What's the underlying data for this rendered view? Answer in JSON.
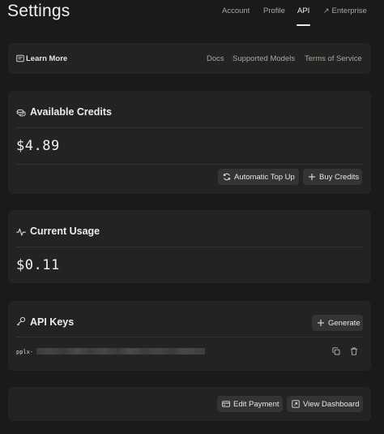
{
  "header": {
    "title": "Settings",
    "tabs": [
      {
        "label": "Account"
      },
      {
        "label": "Profile"
      },
      {
        "label": "API"
      },
      {
        "label": "Enterprise"
      }
    ],
    "active_tab": "API"
  },
  "learn_more": {
    "label": "Learn More",
    "links": [
      "Docs",
      "Supported Models",
      "Terms of Service"
    ]
  },
  "credits": {
    "title": "Available Credits",
    "amount": "$4.89",
    "auto_top_up_label": "Automatic Top Up",
    "buy_label": "Buy Credits"
  },
  "usage": {
    "title": "Current Usage",
    "amount": "$0.11"
  },
  "api_keys": {
    "title": "API Keys",
    "generate_label": "Generate",
    "key_prefix": "pplx-"
  },
  "footer_actions": {
    "edit_payment_label": "Edit Payment",
    "view_dashboard_label": "View Dashboard"
  },
  "colors": {
    "background": "#1a1a1a",
    "card": "#232322",
    "button": "#343433",
    "text": "#e8e8e6",
    "muted": "#a7a7a4"
  },
  "icons": [
    "external-link-icon",
    "book-icon",
    "coins-icon",
    "refresh-icon",
    "plus-icon",
    "activity-icon",
    "key-icon",
    "copy-icon",
    "trash-icon",
    "credit-card-icon",
    "dashboard-icon"
  ]
}
